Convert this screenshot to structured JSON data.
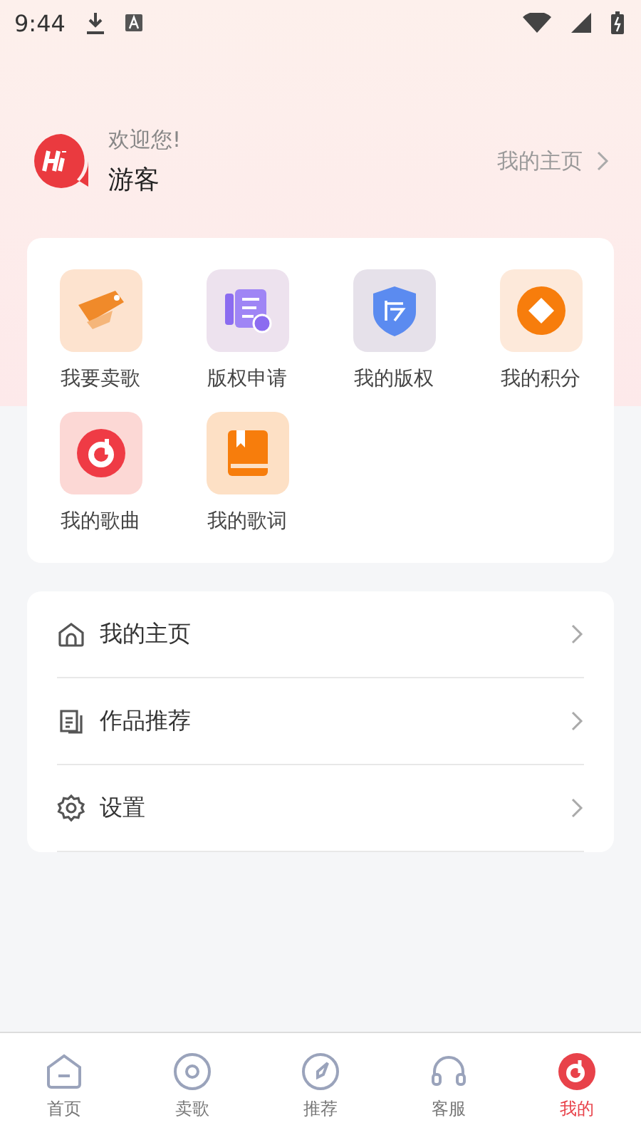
{
  "status_bar": {
    "time": "9:44"
  },
  "profile": {
    "greeting": "欢迎您!",
    "name": "游客",
    "home_link": "我的主页"
  },
  "shortcuts": [
    {
      "label": "我要卖歌"
    },
    {
      "label": "版权申请"
    },
    {
      "label": "我的版权"
    },
    {
      "label": "我的积分"
    },
    {
      "label": "我的歌曲"
    },
    {
      "label": "我的歌词"
    }
  ],
  "menu": [
    {
      "label": "我的主页"
    },
    {
      "label": "作品推荐"
    },
    {
      "label": "设置"
    }
  ],
  "tabs": [
    {
      "label": "首页",
      "selected": false
    },
    {
      "label": "卖歌",
      "selected": false
    },
    {
      "label": "推荐",
      "selected": false
    },
    {
      "label": "客服",
      "selected": false
    },
    {
      "label": "我的",
      "selected": true
    }
  ]
}
